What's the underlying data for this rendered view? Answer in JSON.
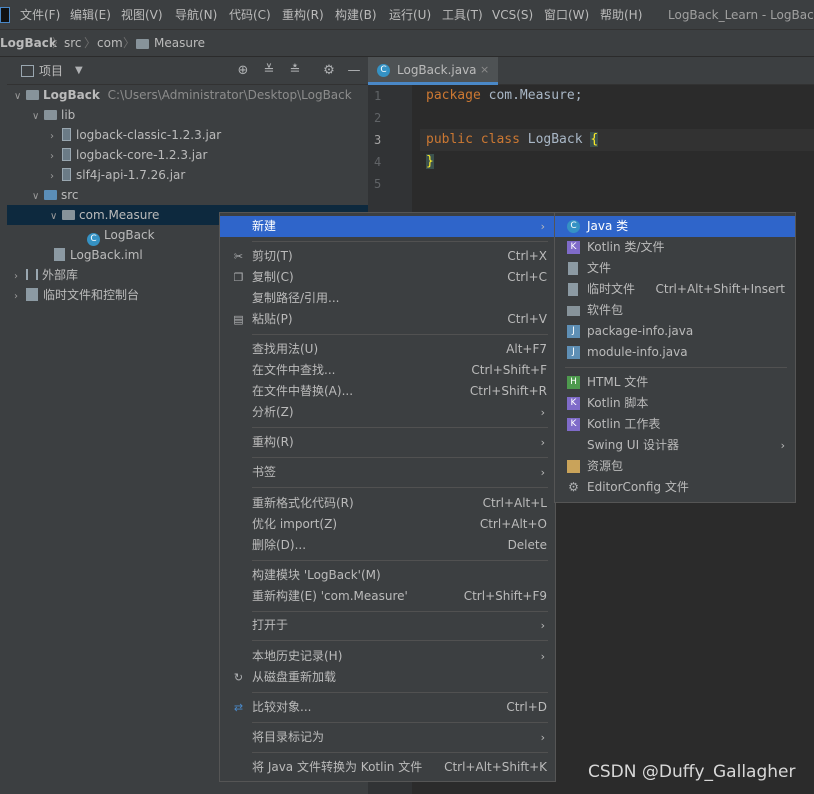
{
  "menubar": {
    "items": [
      "文件(F)",
      "编辑(E)",
      "视图(V)",
      "导航(N)",
      "代码(C)",
      "重构(R)",
      "构建(B)",
      "运行(U)",
      "工具(T)",
      "VCS(S)",
      "窗口(W)",
      "帮助(H)"
    ],
    "title": "LogBack_Learn - LogBack"
  },
  "navbar": {
    "crumbs": [
      "LogBack",
      "src",
      "com",
      "Measure"
    ]
  },
  "project": {
    "header_label": "项目",
    "tree": [
      {
        "label": "LogBack",
        "extra": "C:\\Users\\Administrator\\Desktop\\LogBack",
        "icon": "folder-icon",
        "indent": 0,
        "chevron": "down"
      },
      {
        "label": "lib",
        "icon": "folder-icon",
        "indent": 1,
        "chevron": "down"
      },
      {
        "label": "logback-classic-1.2.3.jar",
        "icon": "jar-icon",
        "indent": 2,
        "chevron": "right"
      },
      {
        "label": "logback-core-1.2.3.jar",
        "icon": "jar-icon",
        "indent": 2,
        "chevron": "right"
      },
      {
        "label": "slf4j-api-1.7.26.jar",
        "icon": "jar-icon",
        "indent": 2,
        "chevron": "right"
      },
      {
        "label": "src",
        "icon": "folder-icon",
        "indent": 1,
        "chevron": "down"
      },
      {
        "label": "com.Measure",
        "icon": "package-icon",
        "indent": 2,
        "chevron": "down",
        "selected": true
      },
      {
        "label": "LogBack",
        "icon": "class-icon",
        "indent": 4,
        "chevron": ""
      },
      {
        "label": "LogBack.iml",
        "icon": "file-icon",
        "indent": 2,
        "chevron": ""
      },
      {
        "label": "外部库",
        "icon": "library-icon",
        "indent": 0,
        "chevron": "right"
      },
      {
        "label": "临时文件和控制台",
        "icon": "scratch-icon",
        "indent": 0,
        "chevron": "right"
      }
    ]
  },
  "editor": {
    "tab_label": "LogBack.java",
    "line_numbers": [
      "1",
      "2",
      "3",
      "4",
      "5"
    ],
    "code": {
      "line1_kw": "package",
      "line1_rest": " com.Measure;",
      "line3_kw": "public class",
      "line3_rest": " LogBack ",
      "line3_brace": "{",
      "line4_brace": "}"
    }
  },
  "context_menu": {
    "items": [
      {
        "label": "新建",
        "shortcut": "",
        "arrow": true,
        "active": true
      },
      {
        "label": "剪切(T)",
        "shortcut": "Ctrl+X",
        "icon": "scissors-icon"
      },
      {
        "label": "复制(C)",
        "shortcut": "Ctrl+C",
        "icon": "copy-icon"
      },
      {
        "label": "复制路径/引用...",
        "shortcut": ""
      },
      {
        "label": "粘贴(P)",
        "shortcut": "Ctrl+V",
        "icon": "paste-icon"
      },
      {
        "label": "查找用法(U)",
        "shortcut": "Alt+F7"
      },
      {
        "label": "在文件中查找...",
        "shortcut": "Ctrl+Shift+F"
      },
      {
        "label": "在文件中替换(A)...",
        "shortcut": "Ctrl+Shift+R"
      },
      {
        "label": "分析(Z)",
        "shortcut": "",
        "arrow": true
      },
      {
        "label": "重构(R)",
        "shortcut": "",
        "arrow": true
      },
      {
        "label": "书签",
        "shortcut": "",
        "arrow": true
      },
      {
        "label": "重新格式化代码(R)",
        "shortcut": "Ctrl+Alt+L"
      },
      {
        "label": "优化 import(Z)",
        "shortcut": "Ctrl+Alt+O"
      },
      {
        "label": "删除(D)...",
        "shortcut": "Delete"
      },
      {
        "label": "构建模块 'LogBack'(M)",
        "shortcut": ""
      },
      {
        "label": "重新构建(E) 'com.Measure'",
        "shortcut": "Ctrl+Shift+F9"
      },
      {
        "label": "打开于",
        "shortcut": "",
        "arrow": true
      },
      {
        "label": "本地历史记录(H)",
        "shortcut": "",
        "arrow": true
      },
      {
        "label": "从磁盘重新加载",
        "shortcut": "",
        "icon": "reload-icon"
      },
      {
        "label": "比较对象...",
        "shortcut": "Ctrl+D",
        "icon": "compare-icon"
      },
      {
        "label": "将目录标记为",
        "shortcut": "",
        "arrow": true
      },
      {
        "label": "将 Java 文件转换为 Kotlin 文件",
        "shortcut": "Ctrl+Alt+Shift+K"
      }
    ]
  },
  "new_submenu": {
    "items": [
      {
        "label": "Java 类",
        "shortcut": "",
        "active": true,
        "icon": "java-class-icon",
        "color": "#3592c4",
        "glyph": "C"
      },
      {
        "label": "Kotlin 类/文件",
        "shortcut": "",
        "icon": "kotlin-file-icon",
        "color": "#7f6bc9",
        "glyph": "K"
      },
      {
        "label": "文件",
        "shortcut": "",
        "icon": "file-icon",
        "color": "#8c9aa3",
        "glyph": ""
      },
      {
        "label": "临时文件",
        "shortcut": "Ctrl+Alt+Shift+Insert",
        "icon": "scratch-file-icon",
        "color": "#8c9aa3",
        "glyph": ""
      },
      {
        "label": "软件包",
        "shortcut": "",
        "icon": "package-icon",
        "color": "#87939a",
        "glyph": ""
      },
      {
        "label": "package-info.java",
        "shortcut": "",
        "icon": "java-file-icon",
        "color": "#5e8fb5",
        "glyph": "J"
      },
      {
        "label": "module-info.java",
        "shortcut": "",
        "icon": "java-file-icon",
        "color": "#5e8fb5",
        "glyph": "J"
      },
      {
        "label": "HTML 文件",
        "shortcut": "",
        "icon": "html-file-icon",
        "color": "#4e9a4e",
        "glyph": "H"
      },
      {
        "label": "Kotlin 脚本",
        "shortcut": "",
        "icon": "kotlin-script-icon",
        "color": "#7f6bc9",
        "glyph": "K"
      },
      {
        "label": "Kotlin 工作表",
        "shortcut": "",
        "icon": "kotlin-worksheet-icon",
        "color": "#7f6bc9",
        "glyph": "K"
      },
      {
        "label": "Swing UI 设计器",
        "shortcut": "",
        "arrow": true
      },
      {
        "label": "资源包",
        "shortcut": "",
        "icon": "resource-bundle-icon",
        "color": "#c9a35a",
        "glyph": ""
      },
      {
        "label": "EditorConfig 文件",
        "shortcut": "",
        "icon": "gear-icon",
        "color": "#8c9aa3",
        "glyph": "⚙"
      }
    ]
  },
  "watermark": "CSDN @Duffy_Gallagher"
}
